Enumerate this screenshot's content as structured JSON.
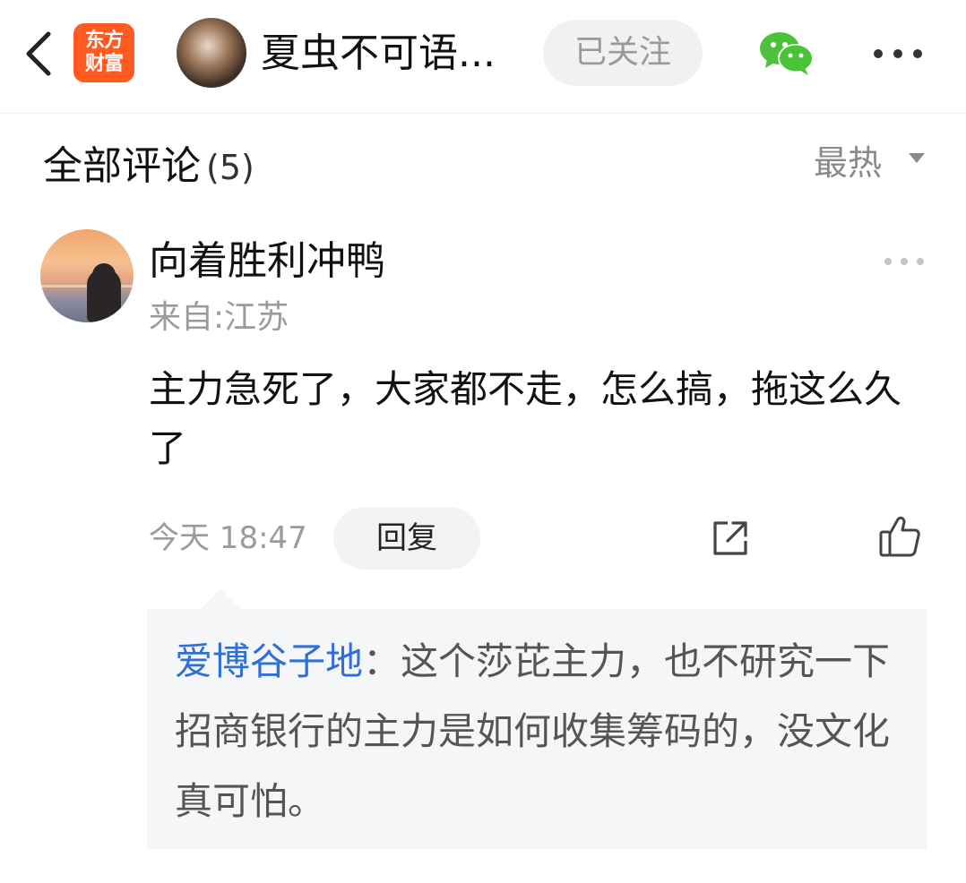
{
  "header": {
    "logo_line1": "东方",
    "logo_line2": "财富",
    "user_name": "夏虫不可语...",
    "follow_label": "已关注"
  },
  "comments_header": {
    "title": "全部评论",
    "count": "(5)",
    "sort_label": "最热"
  },
  "comment": {
    "author": "向着胜利冲鸭",
    "from": "来自:江苏",
    "text": "主力急死了，大家都不走，怎么搞，拖这么久了",
    "time": "今天 18:47",
    "reply_label": "回复"
  },
  "reply": {
    "user": "爱博谷子地",
    "text": "：这个莎芘主力，也不研究一下招商银行的主力是如何收集筹码的，没文化真可怕。"
  },
  "colors": {
    "brand": "#ff5a1f",
    "link": "#2f6fd6",
    "wechat_green": "#4cc23a"
  },
  "icons": [
    "back-arrow-icon",
    "wechat-icon",
    "more-icon",
    "sort-down-icon",
    "share-icon",
    "like-icon"
  ]
}
